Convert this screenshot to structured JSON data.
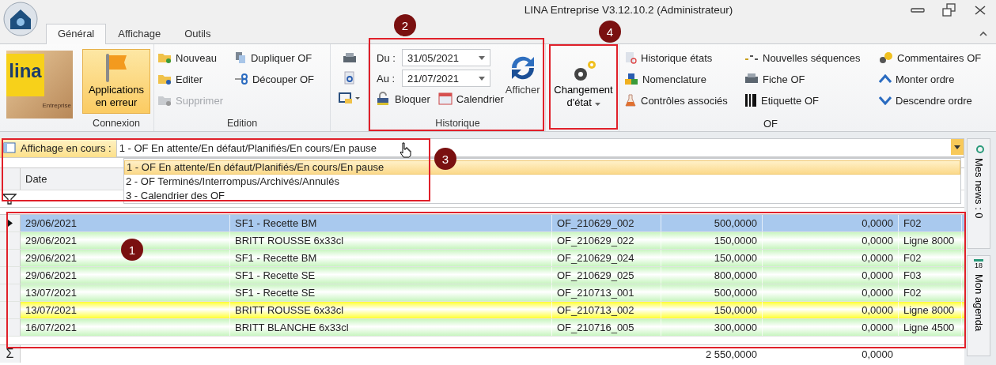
{
  "window": {
    "title": "LINA Entreprise  V3.12.10.2  (Administrateur)"
  },
  "tabs": [
    {
      "label": "Général",
      "selected": true
    },
    {
      "label": "Affichage",
      "selected": false
    },
    {
      "label": "Outils",
      "selected": false
    }
  ],
  "ribbon": {
    "logo": {
      "text": "lina",
      "subtext": "Entreprise"
    },
    "connexion": {
      "button": "Applications en erreur",
      "label": "Connexion"
    },
    "edition": {
      "items": [
        {
          "label": "Nouveau",
          "disabled": false
        },
        {
          "label": "Editer",
          "disabled": false
        },
        {
          "label": "Supprimer",
          "disabled": true
        },
        {
          "label": "Dupliquer OF",
          "disabled": false
        },
        {
          "label": "Découper OF",
          "disabled": false
        }
      ],
      "label": "Edition"
    },
    "historique": {
      "from_label": "Du :",
      "from": "31/05/2021",
      "to_label": "Au :",
      "to": "21/07/2021",
      "refresh": "Afficher",
      "lock": "Bloquer",
      "calendar": "Calendrier",
      "label": "Historique"
    },
    "state_change": {
      "button": "Changement d'état"
    },
    "of": {
      "columns": [
        [
          "Historique états",
          "Nomenclature",
          "Contrôles associés"
        ],
        [
          "Nouvelles séquences",
          "Fiche OF",
          "Etiquette OF"
        ],
        [
          "Commentaires OF",
          "Monter ordre",
          "Descendre ordre"
        ]
      ],
      "label": "OF"
    }
  },
  "view_selector": {
    "label": "Affichage en cours :",
    "value": "1 - OF En attente/En défaut/Planifiés/En cours/En pause",
    "options": [
      {
        "label": "1 - OF En attente/En défaut/Planifiés/En cours/En pause",
        "selected": true
      },
      {
        "label": "2 - OF Terminés/Interrompus/Archivés/Annulés",
        "selected": false
      },
      {
        "label": "3 - Calendrier des OF",
        "selected": false
      }
    ]
  },
  "table": {
    "columns": [
      "Date"
    ],
    "rows": [
      {
        "cells": [
          "29/06/2021",
          "SF1 - Recette BM",
          "OF_210629_002",
          "500,0000",
          "0,0000",
          "F02"
        ],
        "selected": true
      },
      {
        "cells": [
          "29/06/2021",
          "BRITT ROUSSE 6x33cl",
          "OF_210629_022",
          "150,0000",
          "0,0000",
          "Ligne 8000"
        ],
        "selected": false,
        "color": "#c8f5c0"
      },
      {
        "cells": [
          "29/06/2021",
          "SF1 - Recette BM",
          "OF_210629_024",
          "150,0000",
          "0,0000",
          "F02"
        ],
        "selected": false,
        "color": "#c8f5c0"
      },
      {
        "cells": [
          "29/06/2021",
          "SF1 - Recette SE",
          "OF_210629_025",
          "800,0000",
          "0,0000",
          "F03"
        ],
        "selected": false,
        "color": "#c8f5c0"
      },
      {
        "cells": [
          "13/07/2021",
          "SF1 - Recette SE",
          "OF_210713_001",
          "500,0000",
          "0,0000",
          "F02"
        ],
        "selected": false,
        "color": "#c8f5c0"
      },
      {
        "cells": [
          "13/07/2021",
          "BRITT ROUSSE 6x33cl",
          "OF_210713_002",
          "150,0000",
          "0,0000",
          "Ligne 8000"
        ],
        "selected": false,
        "color": "#ffff30"
      },
      {
        "cells": [
          "16/07/2021",
          "BRITT BLANCHE 6x33cl",
          "OF_210716_005",
          "300,0000",
          "0,0000",
          "Ligne 4500"
        ],
        "selected": false,
        "color": "#c8f5c0"
      }
    ],
    "sum_symbol": "Σ",
    "totals": [
      "2 550,0000",
      "0,0000"
    ]
  },
  "side_tabs": [
    "Mes news : 0",
    "Mon agenda"
  ],
  "agenda_day": "18",
  "annotations": [
    "1",
    "2",
    "3",
    "4"
  ]
}
